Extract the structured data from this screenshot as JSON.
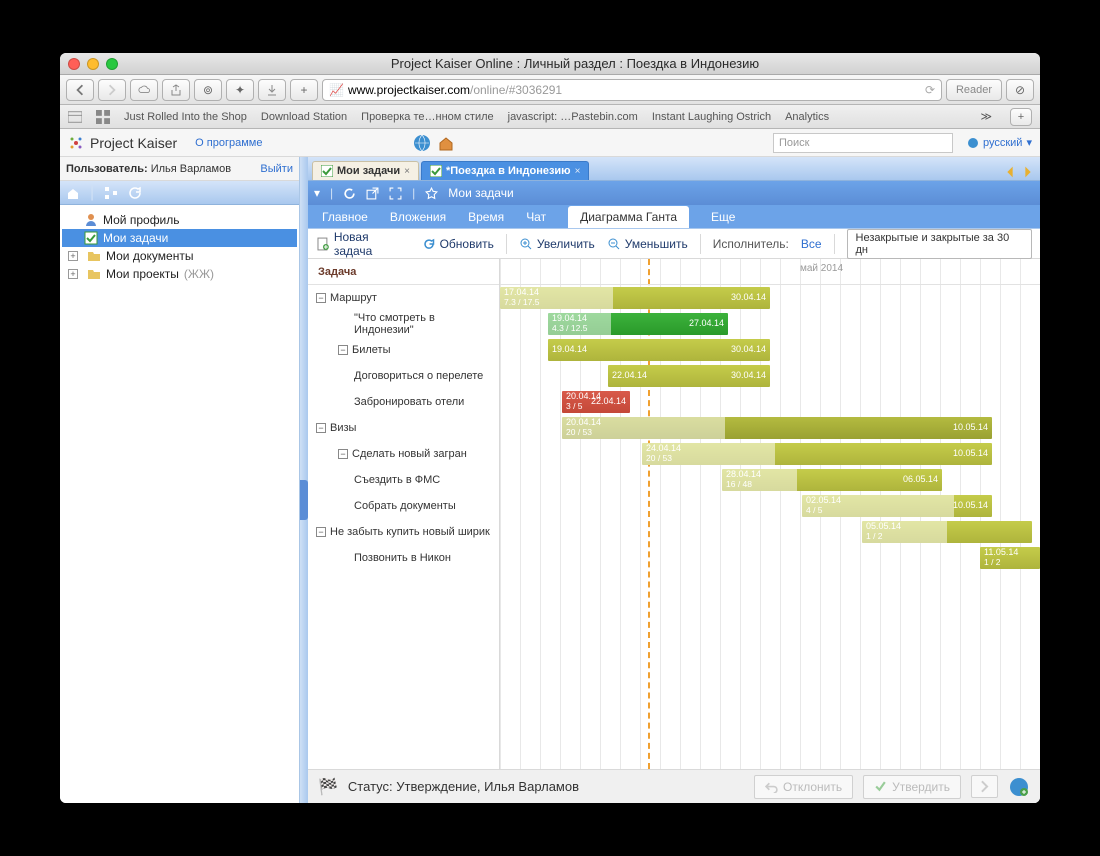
{
  "window": {
    "title": "Project Kaiser Online : Личный раздел : Поездка в Индонезию"
  },
  "browser": {
    "url_host": "www.projectkaiser.com",
    "url_path": "/online/#3036291",
    "reader": "Reader",
    "bookmarks": [
      "Just Rolled Into the Shop",
      "Download Station",
      "Проверка те…нном стиле",
      "javascript: …Pastebin.com",
      "Instant Laughing Ostrich",
      "Analytics"
    ]
  },
  "app": {
    "brand": "Project Kaiser",
    "about": "О программе",
    "search_placeholder": "Поиск",
    "language": "русский"
  },
  "user_bar": {
    "label": "Пользователь:",
    "name": "Илья Варламов",
    "logout": "Выйти"
  },
  "tree": {
    "profile": "Мой профиль",
    "tasks": "Мои задачи",
    "documents": "Мои документы",
    "projects": "Мои проекты",
    "projects_suffix": "(ЖЖ)"
  },
  "tabs": {
    "t1": "Мои задачи",
    "t2": "*Поездка в Индонезию"
  },
  "doc_toolbar_title": "Мои задачи",
  "doc_tabs": [
    "Главное",
    "Вложения",
    "Время",
    "Чат",
    "Диаграмма Ганта",
    "Еще"
  ],
  "gantt_toolbar": {
    "new_task": "Новая задача",
    "refresh": "Обновить",
    "zoom_in": "Увеличить",
    "zoom_out": "Уменьшить",
    "assignee_label": "Исполнитель:",
    "assignee_value": "Все",
    "filter": "Незакрытые и закрытые за 30 дн"
  },
  "gantt": {
    "task_header": "Задача",
    "month_label": "май 2014",
    "rows": [
      {
        "name": "Маршрут",
        "level": 0,
        "pm": "−"
      },
      {
        "name": "\"Что смотреть в Индонезии\"",
        "level": 2
      },
      {
        "name": "Билеты",
        "level": 1,
        "pm": "−"
      },
      {
        "name": "Договориться о перелете",
        "level": 2
      },
      {
        "name": "Забронировать отели",
        "level": 2
      },
      {
        "name": "Визы",
        "level": 0,
        "pm": "−"
      },
      {
        "name": "Сделать новый загран",
        "level": 1,
        "pm": "−"
      },
      {
        "name": "Съездить в ФМС",
        "level": 2
      },
      {
        "name": "Собрать документы",
        "level": 2
      },
      {
        "name": "Не забыть купить новый ширик",
        "level": 0,
        "pm": "−"
      },
      {
        "name": "Позвонить в Никон",
        "level": 2
      }
    ]
  },
  "footer": {
    "status": "Статус: Утверждение, Илья Варламов",
    "reject": "Отклонить",
    "approve": "Утвердить"
  },
  "chart_data": {
    "type": "gantt",
    "rows": [
      {
        "task": "Маршрут",
        "start": "17.04.14",
        "end": "30.04.14",
        "progress_label": "7.3 / 17.5",
        "color": "olive"
      },
      {
        "task": "\"Что смотреть в Индонезии\"",
        "start": "19.04.14",
        "end": "27.04.14",
        "progress_label": "4.3 / 12.5",
        "color": "green"
      },
      {
        "task": "Билеты",
        "start": "19.04.14",
        "end": "30.04.14",
        "color": "olive"
      },
      {
        "task": "Договориться о перелете",
        "start": "22.04.14",
        "end": "30.04.14",
        "color": "olive"
      },
      {
        "task": "Забронировать отели",
        "start": "20.04.14",
        "end": "22.04.14",
        "progress_label": "3 / 5",
        "color": "red"
      },
      {
        "task": "Визы",
        "start": "20.04.14",
        "end": "10.05.14",
        "progress_label": "20 / 53",
        "color": "olive"
      },
      {
        "task": "Сделать новый загран",
        "start": "24.04.14",
        "end": "10.05.14",
        "progress_label": "20 / 53",
        "color": "olive"
      },
      {
        "task": "Съездить в ФМС",
        "start": "28.04.14",
        "end": "06.05.14",
        "progress_label": "16 / 48",
        "color": "olive"
      },
      {
        "task": "Собрать документы",
        "start": "02.05.14",
        "end": "10.05.14",
        "progress_label": "4 / 5",
        "color": "olive"
      },
      {
        "task": "Не забыть купить новый ширик",
        "start": "05.05.14",
        "progress_label": "1 / 2",
        "color": "olive"
      },
      {
        "task": "Позвонить в Никон",
        "start": "11.05.14",
        "progress_label": "1 / 2",
        "color": "olive"
      }
    ]
  }
}
